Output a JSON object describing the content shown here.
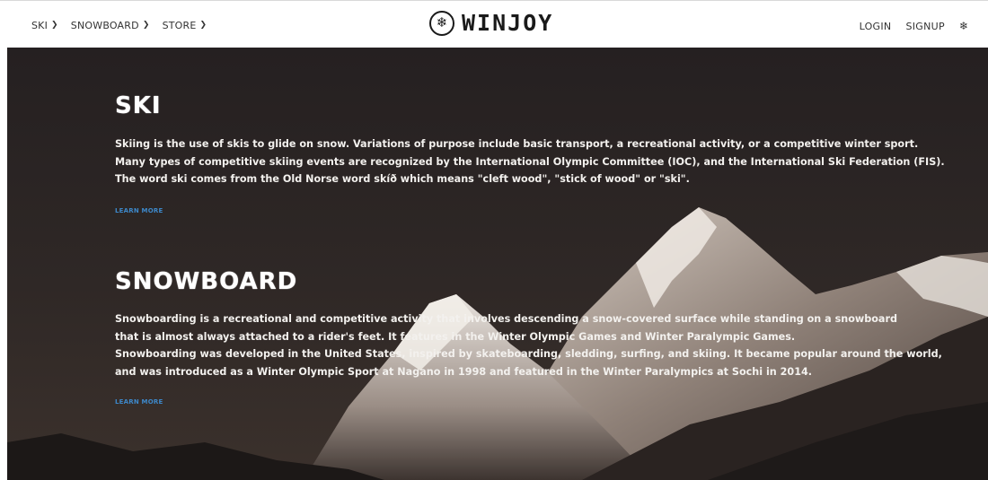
{
  "nav": {
    "left_items": [
      {
        "label": "SKI"
      },
      {
        "label": "SNOWBOARD"
      },
      {
        "label": "STORE"
      }
    ],
    "brand": "WINJOY",
    "login": "LOGIN",
    "signup": "SIGNUP"
  },
  "sections": [
    {
      "title": "SKI",
      "lines": [
        "Skiing is the use of skis to glide on snow. Variations of purpose include basic transport, a recreational activity, or a competitive winter sport.",
        "Many types of competitive skiing events are recognized by the International Olympic Committee (IOC), and the International Ski Federation (FIS).",
        "The word ski comes from the Old Norse word skíð which means \"cleft wood\", \"stick of wood\" or \"ski\"."
      ],
      "link": "LEARN MORE"
    },
    {
      "title": "SNOWBOARD",
      "lines": [
        "Snowboarding is a recreational and competitive activity that involves descending a snow-covered surface while standing on a snowboard",
        "that is almost always attached to a rider's feet. It features in the Winter Olympic Games and Winter Paralympic Games.",
        "Snowboarding was developed in the United States, inspired by skateboarding, sledding, surfing, and skiing. It became popular around the world,",
        "and was introduced as a Winter Olympic Sport at Nagano in 1998 and featured in the Winter Paralympics at Sochi in 2014."
      ],
      "link": "LEARN MORE"
    }
  ],
  "colors": {
    "link": "#3d88c9",
    "hero_bg": "#2a2524"
  }
}
